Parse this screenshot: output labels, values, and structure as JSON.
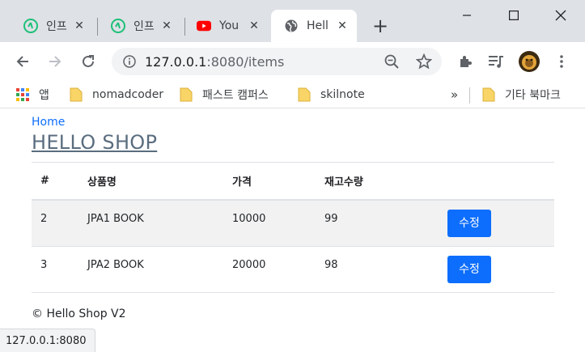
{
  "browser": {
    "tabs": [
      {
        "title": "인프",
        "favicon": "inflearn-icon"
      },
      {
        "title": "인프",
        "favicon": "inflearn-icon"
      },
      {
        "title": "You",
        "favicon": "youtube-icon"
      },
      {
        "title": "Hell",
        "favicon": "globe-icon",
        "active": true
      }
    ],
    "url_host": "127.0.0.1",
    "url_rest": ":8080/items",
    "colors": {
      "tabstrip": "#dee1e6",
      "youtube_red": "#ff0000",
      "inflearn_green": "#1dc078",
      "folder_yellow": "#f9d466"
    }
  },
  "bookmarks": {
    "items": [
      {
        "label": "앱",
        "icon": "apps-grid-icon"
      },
      {
        "label": "nomadcoder",
        "icon": "folder-icon"
      },
      {
        "label": "패스트 캠퍼스",
        "icon": "folder-icon"
      },
      {
        "label": "skilnote",
        "icon": "folder-icon"
      }
    ],
    "overflow": "»",
    "other": "기타 북마크"
  },
  "page": {
    "breadcrumb": "Home",
    "title": "HELLO SHOP",
    "columns": [
      "#",
      "상품명",
      "가격",
      "재고수량",
      ""
    ],
    "rows": [
      {
        "id": "2",
        "name": "JPA1 BOOK",
        "price": "10000",
        "stock": "99",
        "action": "수정"
      },
      {
        "id": "3",
        "name": "JPA2 BOOK",
        "price": "20000",
        "stock": "98",
        "action": "수정"
      }
    ],
    "footer": "© Hello Shop V2",
    "colors": {
      "primary": "#0d6efd",
      "title": "#5a6d7f",
      "striped_row": "#f2f2f2"
    }
  },
  "status": "127.0.0.1:8080"
}
